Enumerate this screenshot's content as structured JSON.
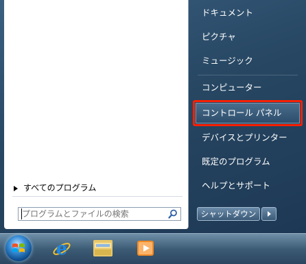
{
  "search": {
    "placeholder": "プログラムとファイルの検索"
  },
  "left": {
    "all_programs": "すべてのプログラム"
  },
  "right": {
    "items": [
      {
        "label": "ドキュメント"
      },
      {
        "label": "ピクチャ"
      },
      {
        "label": "ミュージック"
      },
      {
        "label": "コンピューター"
      },
      {
        "label": "コントロール パネル"
      },
      {
        "label": "デバイスとプリンター"
      },
      {
        "label": "既定のプログラム"
      },
      {
        "label": "ヘルプとサポート"
      }
    ]
  },
  "shutdown": {
    "label": "シャットダウン"
  },
  "highlight_color": "#ff2000",
  "taskbar": {
    "icons": [
      "windows-orb-icon",
      "internet-explorer-icon",
      "windows-explorer-icon",
      "media-player-icon"
    ]
  }
}
